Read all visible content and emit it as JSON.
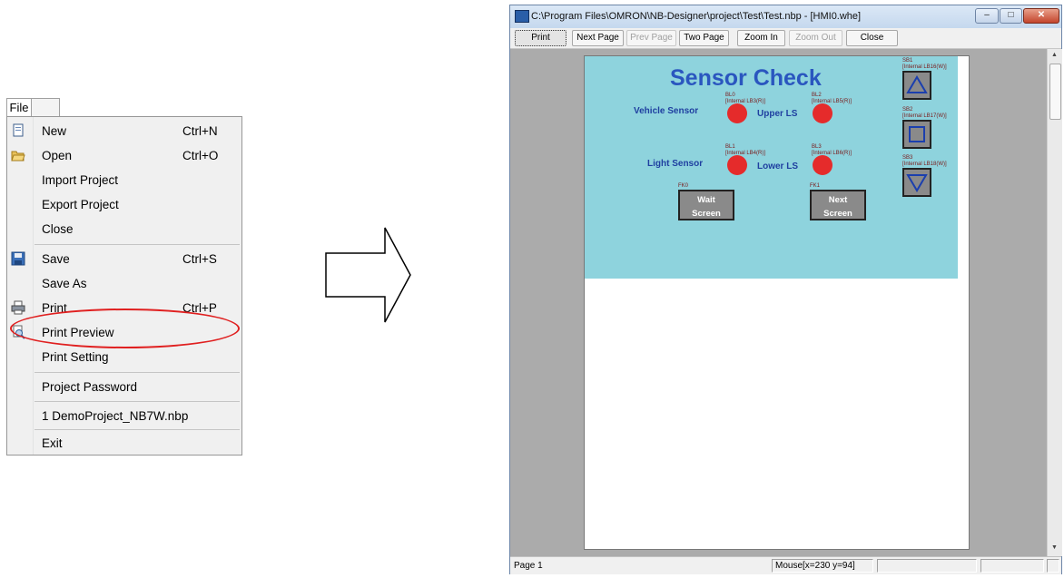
{
  "menu": {
    "title": "File",
    "items": [
      {
        "label": "New",
        "shortcut": "Ctrl+N",
        "icon": "new-file-icon"
      },
      {
        "label": "Open",
        "shortcut": "Ctrl+O",
        "icon": "open-folder-icon"
      },
      {
        "label": "Import Project",
        "shortcut": "",
        "icon": ""
      },
      {
        "label": "Export Project",
        "shortcut": "",
        "icon": ""
      },
      {
        "label": "Close",
        "shortcut": "",
        "icon": ""
      },
      {
        "label": "Save",
        "shortcut": "Ctrl+S",
        "icon": "save-disk-icon"
      },
      {
        "label": "Save As",
        "shortcut": "",
        "icon": ""
      },
      {
        "label": "Print",
        "shortcut": "Ctrl+P",
        "icon": "printer-icon"
      },
      {
        "label": "Print Preview",
        "shortcut": "",
        "icon": "print-preview-icon",
        "highlighted": true
      },
      {
        "label": "Print Setting",
        "shortcut": "",
        "icon": ""
      },
      {
        "label": "Project Password",
        "shortcut": "",
        "icon": ""
      },
      {
        "label": "1 DemoProject_NB7W.nbp",
        "shortcut": "",
        "icon": ""
      },
      {
        "label": "Exit",
        "shortcut": "",
        "icon": ""
      }
    ]
  },
  "window": {
    "title": "C:\\Program Files\\OMRON\\NB-Designer\\project\\Test\\Test.nbp - [HMI0.whe]",
    "controls": [
      "minimize",
      "maximize",
      "close"
    ]
  },
  "toolbar": {
    "buttons": [
      {
        "label": "Print",
        "enabled": true
      },
      {
        "label": "Next Page",
        "enabled": true
      },
      {
        "label": "Prev Page",
        "enabled": false
      },
      {
        "label": "Two Page",
        "enabled": true
      },
      {
        "label": "Zoom In",
        "enabled": true
      },
      {
        "label": "Zoom Out",
        "enabled": false
      },
      {
        "label": "Close",
        "enabled": true
      }
    ]
  },
  "screen": {
    "heading": "Sensor Check",
    "sensors": {
      "vehicle": "Vehicle Sensor",
      "upper": "Upper LS",
      "light": "Light Sensor",
      "lower": "Lower LS"
    },
    "tags": {
      "bl0_id": "BL0",
      "bl0_addr": "[Internal LB3(R)]",
      "bl1_id": "BL1",
      "bl1_addr": "[Internal LB4(R)]",
      "bl2_id": "BL2",
      "bl2_addr": "[Internal LB5(R)]",
      "bl3_id": "BL3",
      "bl3_addr": "[Internal LB6(R)]",
      "fk0": "FK0",
      "fk1": "FK1",
      "sb1_id": "SB1",
      "sb1_addr": "[Internal LB16(W)]",
      "sb2_id": "SB2",
      "sb2_addr": "[Internal LB17(W)]",
      "sb3_id": "SB3",
      "sb3_addr": "[Internal LB18(W)]"
    },
    "buttons": {
      "wait_line1": "Wait",
      "wait_line2": "Screen",
      "next_line1": "Next",
      "next_line2": "Screen"
    },
    "colors": {
      "background": "#8ed3dd",
      "lamp": "#e52b2b",
      "heading": "#2a56bf"
    }
  },
  "status": {
    "page": "Page 1",
    "mouse": "Mouse[x=230  y=94]"
  }
}
